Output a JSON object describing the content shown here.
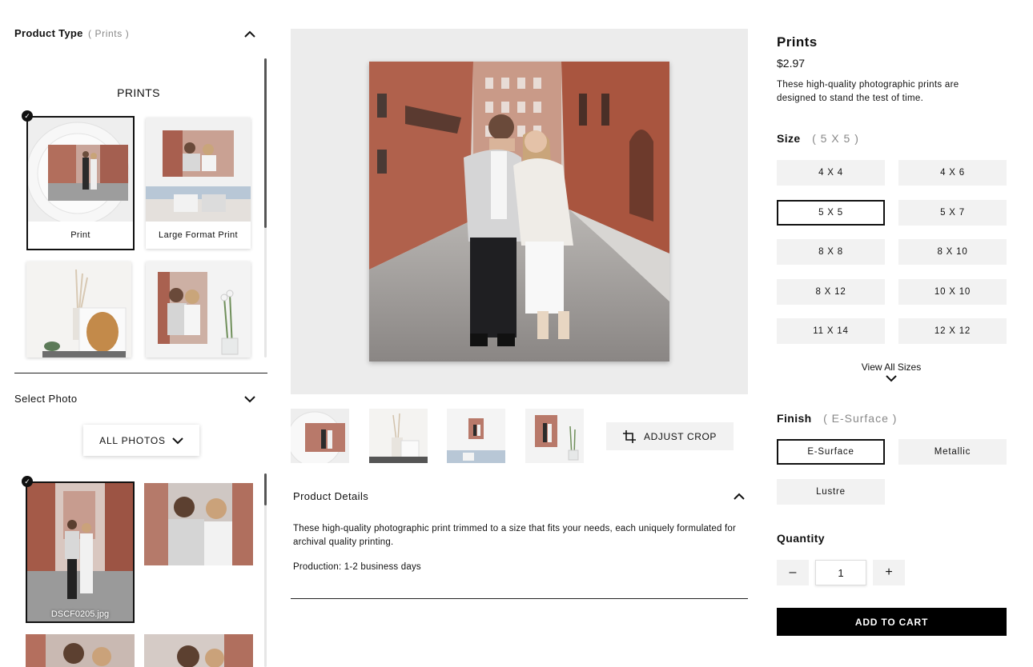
{
  "product_type": {
    "title": "Product Type",
    "selected": "( Prints )",
    "section_heading": "PRINTS",
    "cards": [
      {
        "label": "Print"
      },
      {
        "label": "Large Format Print"
      },
      {
        "label": ""
      },
      {
        "label": ""
      }
    ]
  },
  "select_photo": {
    "title": "Select Photo",
    "filter_label": "ALL PHOTOS",
    "selected_file": "DSCF0205.jpg"
  },
  "preview": {
    "adjust_crop_label": "ADJUST CROP"
  },
  "product_details": {
    "title": "Product Details",
    "description": "These high-quality photographic print trimmed to a size that fits your needs, each uniquely formulated for archival quality printing.",
    "production": "Production: 1-2 business days"
  },
  "product": {
    "name": "Prints",
    "price": "$2.97",
    "description": "These high-quality photographic prints are designed to stand the test of time."
  },
  "size": {
    "label": "Size",
    "selected": "( 5 X 5 )",
    "options": [
      "4 X 4",
      "4 X 6",
      "5 X 5",
      "5 X 7",
      "8 X 8",
      "8 X 10",
      "8 X 12",
      "10 X 10",
      "11 X 14",
      "12 X 12"
    ],
    "view_all": "View All Sizes"
  },
  "finish": {
    "label": "Finish",
    "selected": "( E-Surface )",
    "options": [
      "E-Surface",
      "Metallic",
      "Lustre"
    ]
  },
  "quantity": {
    "label": "Quantity",
    "value": "1",
    "minus": "–",
    "plus": "+"
  },
  "cart": {
    "label": "ADD TO CART"
  },
  "icons": {
    "check": "check-icon",
    "chevron_up": "chevron-up-icon",
    "chevron_down": "chevron-down-icon",
    "crop": "crop-icon"
  }
}
